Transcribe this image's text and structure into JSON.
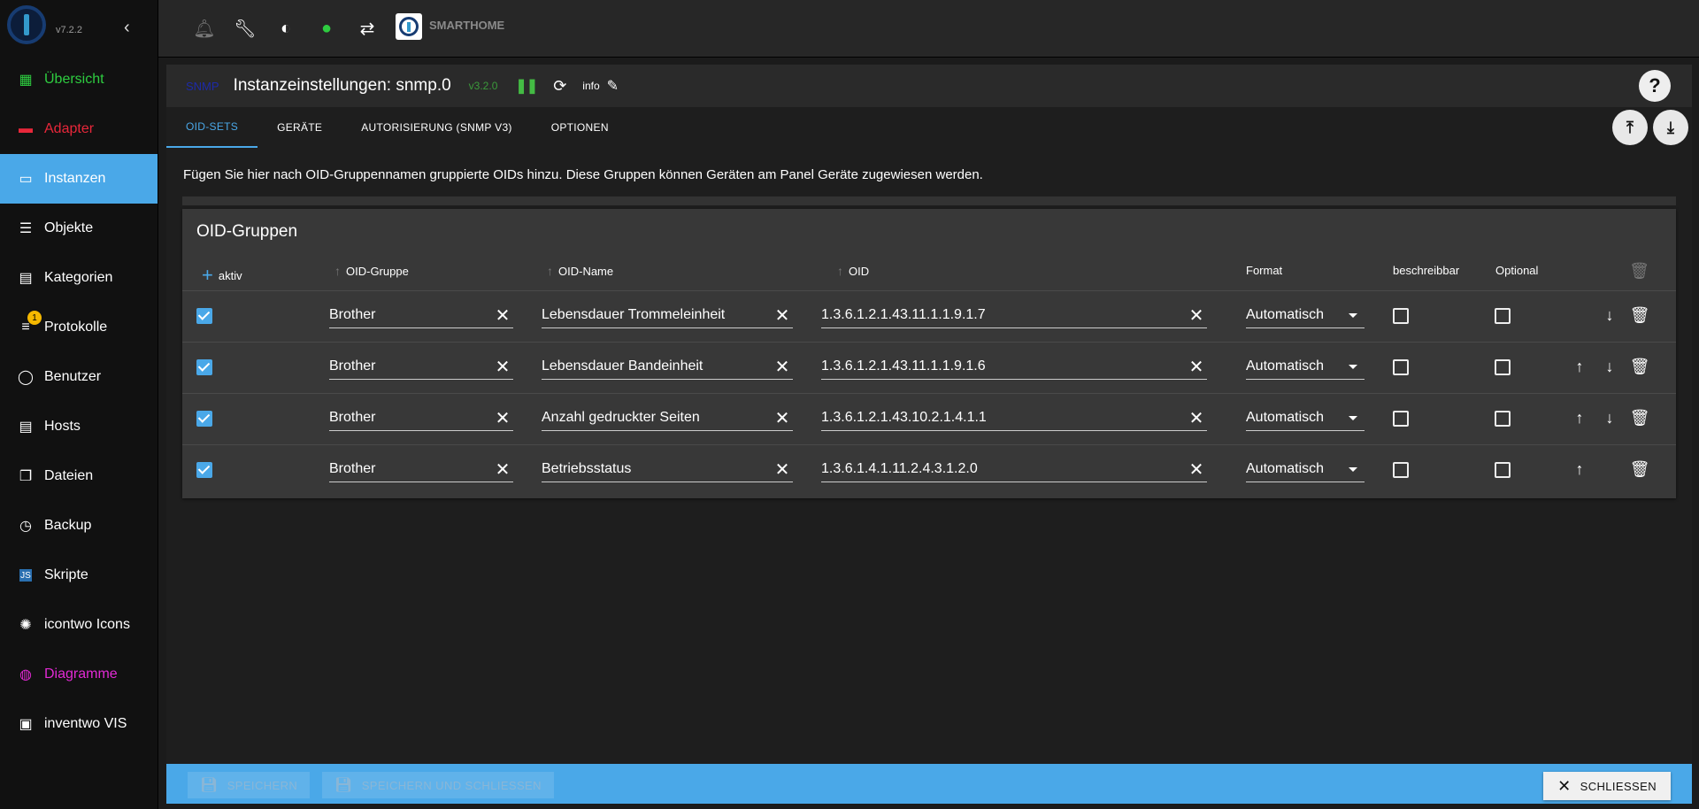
{
  "app": {
    "version": "v7.2.2",
    "brand": "SMARTHOME"
  },
  "sidebar": {
    "items": [
      {
        "label": "Übersicht",
        "color": "#2ecc40",
        "icon": "grid-icon"
      },
      {
        "label": "Adapter",
        "color": "#e8273a",
        "icon": "store-icon"
      },
      {
        "label": "Instanzen",
        "color": "#ffffff",
        "icon": "instances-icon",
        "active": true
      },
      {
        "label": "Objekte",
        "color": "#ffffff",
        "icon": "list-icon"
      },
      {
        "label": "Kategorien",
        "color": "#ffffff",
        "icon": "category-icon"
      },
      {
        "label": "Protokolle",
        "color": "#ffffff",
        "icon": "log-icon",
        "badge": "1"
      },
      {
        "label": "Benutzer",
        "color": "#ffffff",
        "icon": "user-icon"
      },
      {
        "label": "Hosts",
        "color": "#ffffff",
        "icon": "hosts-icon"
      },
      {
        "label": "Dateien",
        "color": "#ffffff",
        "icon": "files-icon"
      },
      {
        "label": "Backup",
        "color": "#ffffff",
        "icon": "backup-icon"
      },
      {
        "label": "Skripte",
        "color": "#ffffff",
        "icon": "js-icon"
      },
      {
        "label": "icontwo Icons",
        "color": "#ffffff",
        "icon": "icontwo-icon"
      },
      {
        "label": "Diagramme",
        "color": "#e22ad5",
        "icon": "chart-icon"
      },
      {
        "label": "inventwo VIS",
        "color": "#ffffff",
        "icon": "vis-icon"
      }
    ]
  },
  "instance": {
    "badge": "SNMP",
    "title": "Instanzeinstellungen: snmp.0",
    "version": "v3.2.0",
    "info_label": "info"
  },
  "tabs": [
    "OID-SETS",
    "GERÄTE",
    "AUTORISIERUNG (SNMP V3)",
    "OPTIONEN"
  ],
  "description": "Fügen Sie hier nach OID-Gruppennamen gruppierte OIDs hinzu. Diese Gruppen können Geräten am Panel Geräte zugewiesen werden.",
  "table": {
    "title": "OID-Gruppen",
    "headers": {
      "active": "aktiv",
      "group": "OID-Gruppe",
      "name": "OID-Name",
      "oid": "OID",
      "format": "Format",
      "writable": "beschreibbar",
      "optional": "Optional"
    },
    "rows": [
      {
        "active": true,
        "group": "Brother",
        "name": "Lebensdauer Trommeleinheit",
        "oid": "1.3.6.1.2.1.43.11.1.1.9.1.7",
        "format": "Automatisch",
        "writable": false,
        "optional": false,
        "up": false,
        "down": true
      },
      {
        "active": true,
        "group": "Brother",
        "name": "Lebensdauer Bandeinheit",
        "oid": "1.3.6.1.2.1.43.11.1.1.9.1.6",
        "format": "Automatisch",
        "writable": false,
        "optional": false,
        "up": true,
        "down": true
      },
      {
        "active": true,
        "group": "Brother",
        "name": "Anzahl gedruckter Seiten",
        "oid": "1.3.6.1.2.1.43.10.2.1.4.1.1",
        "format": "Automatisch",
        "writable": false,
        "optional": false,
        "up": true,
        "down": true
      },
      {
        "active": true,
        "group": "Brother",
        "name": "Betriebsstatus",
        "oid": "1.3.6.1.4.1.11.2.4.3.1.2.0",
        "format": "Automatisch",
        "writable": false,
        "optional": false,
        "up": true,
        "down": false
      }
    ]
  },
  "footer": {
    "save": "SPEICHERN",
    "save_close": "SPEICHERN UND SCHLIESSEN",
    "close": "SCHLIESSEN"
  },
  "colors": {
    "accent": "#4aa8e8",
    "success": "#44bb44"
  }
}
